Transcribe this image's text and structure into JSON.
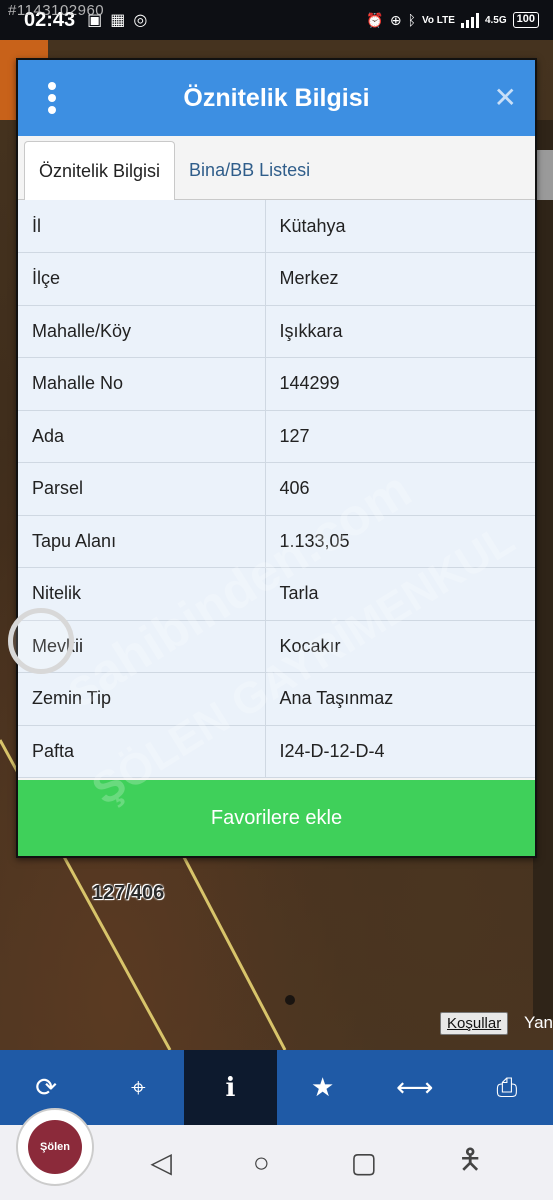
{
  "status_bar": {
    "watermark_id": "#1143102960",
    "time": "02:43",
    "network": "4.5G",
    "battery": "100"
  },
  "dialog": {
    "title": "Öznitelik Bilgisi",
    "tabs": [
      {
        "label": "Öznitelik Bilgisi",
        "active": true
      },
      {
        "label": "Bina/BB Listesi",
        "active": false
      }
    ],
    "rows": [
      {
        "key": "İl",
        "value": "Kütahya"
      },
      {
        "key": "İlçe",
        "value": "Merkez"
      },
      {
        "key": "Mahalle/Köy",
        "value": "Işıkkara"
      },
      {
        "key": "Mahalle No",
        "value": "144299"
      },
      {
        "key": "Ada",
        "value": "127"
      },
      {
        "key": "Parsel",
        "value": "406"
      },
      {
        "key": "Tapu Alanı",
        "value": "1.133,05"
      },
      {
        "key": "Nitelik",
        "value": "Tarla"
      },
      {
        "key": "Mevkii",
        "value": "Kocakır"
      },
      {
        "key": "Zemin Tip",
        "value": "Ana Taşınmaz"
      },
      {
        "key": "Pafta",
        "value": "I24-D-12-D-4"
      }
    ],
    "favorite_button": "Favorilere ekle"
  },
  "map": {
    "parcel_label": "127/406",
    "conditions_link": "Koşullar",
    "edge_text": "Yan"
  },
  "watermarks": {
    "line1": "sahibinden.com",
    "line2": "ŞÖLEN GAYRİMENKUL"
  },
  "logo_text": "Şölen",
  "toolbar": [
    {
      "name": "refresh-icon",
      "glyph": "⟳",
      "active": false
    },
    {
      "name": "locate-icon",
      "glyph": "⌖",
      "active": false
    },
    {
      "name": "info-icon",
      "glyph": "i",
      "active": true
    },
    {
      "name": "star-icon",
      "glyph": "★",
      "active": false
    },
    {
      "name": "measure-icon",
      "glyph": "⟷",
      "active": false
    },
    {
      "name": "print-icon",
      "glyph": "⎙",
      "active": false
    }
  ],
  "colors": {
    "header": "#3d8fe2",
    "favorite": "#3fd05a",
    "toolbar": "#1f5aa6"
  }
}
